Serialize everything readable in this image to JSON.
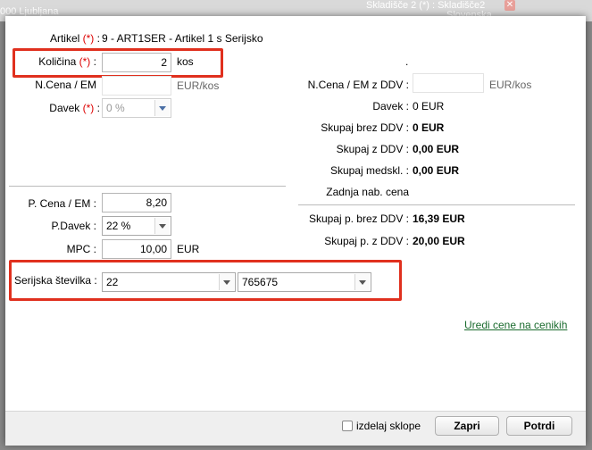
{
  "background": {
    "location_text": "000 Ljubljana",
    "warehouse_text": "Skladišče 2 (*) :  Skladišče2",
    "warehouse_sub": "Slovenska"
  },
  "artikel": {
    "label": "Artikel",
    "req": "(*)",
    "colon": ":",
    "value": "9 - ART1SER - Artikel 1 s Serijsko"
  },
  "kolicina": {
    "label": "Količina",
    "req": "(*)",
    "colon": ":",
    "value": "2",
    "unit": "kos"
  },
  "n_cena_em": {
    "label": "N.Cena / EM",
    "value": "",
    "unit": "EUR/kos"
  },
  "davek_left": {
    "label": "Davek",
    "req": "(*)",
    "colon": ":",
    "selected": "0 %"
  },
  "right_top": {
    "dot": ".",
    "n_cena_ddv": {
      "label": "N.Cena / EM z DDV :",
      "value": "",
      "unit": "EUR/kos"
    },
    "davek": {
      "label": "Davek :",
      "value": "0 EUR"
    },
    "skupaj_brez": {
      "label": "Skupaj brez DDV :",
      "value": "0 EUR"
    },
    "skupaj_z": {
      "label": "Skupaj z DDV :",
      "value": "0,00 EUR"
    },
    "skupaj_medskl": {
      "label": "Skupaj medskl. :",
      "value": "0,00 EUR"
    },
    "zadnja": {
      "label": "Zadnja nab. cena",
      "value": ""
    }
  },
  "pricing": {
    "p_cena": {
      "label": "P. Cena / EM :",
      "value": "8,20"
    },
    "p_davek": {
      "label": "P.Davek :",
      "selected": "22 %"
    },
    "mpc": {
      "label": "MPC :",
      "value": "10,00",
      "unit": "EUR"
    }
  },
  "right_bottom": {
    "skupaj_p_brez": {
      "label": "Skupaj p. brez DDV :",
      "value": "16,39 EUR"
    },
    "skupaj_p_z": {
      "label": "Skupaj p. z DDV :",
      "value": "20,00 EUR"
    }
  },
  "serijska": {
    "label": "Serijska številka :",
    "first": "22",
    "second": "765675"
  },
  "link": "Uredi cene na cenikih",
  "footer": {
    "checkbox_label": "izdelaj sklope",
    "zapri": "Zapri",
    "potrdi": "Potrdi"
  },
  "highlight_color": "#e0301e"
}
